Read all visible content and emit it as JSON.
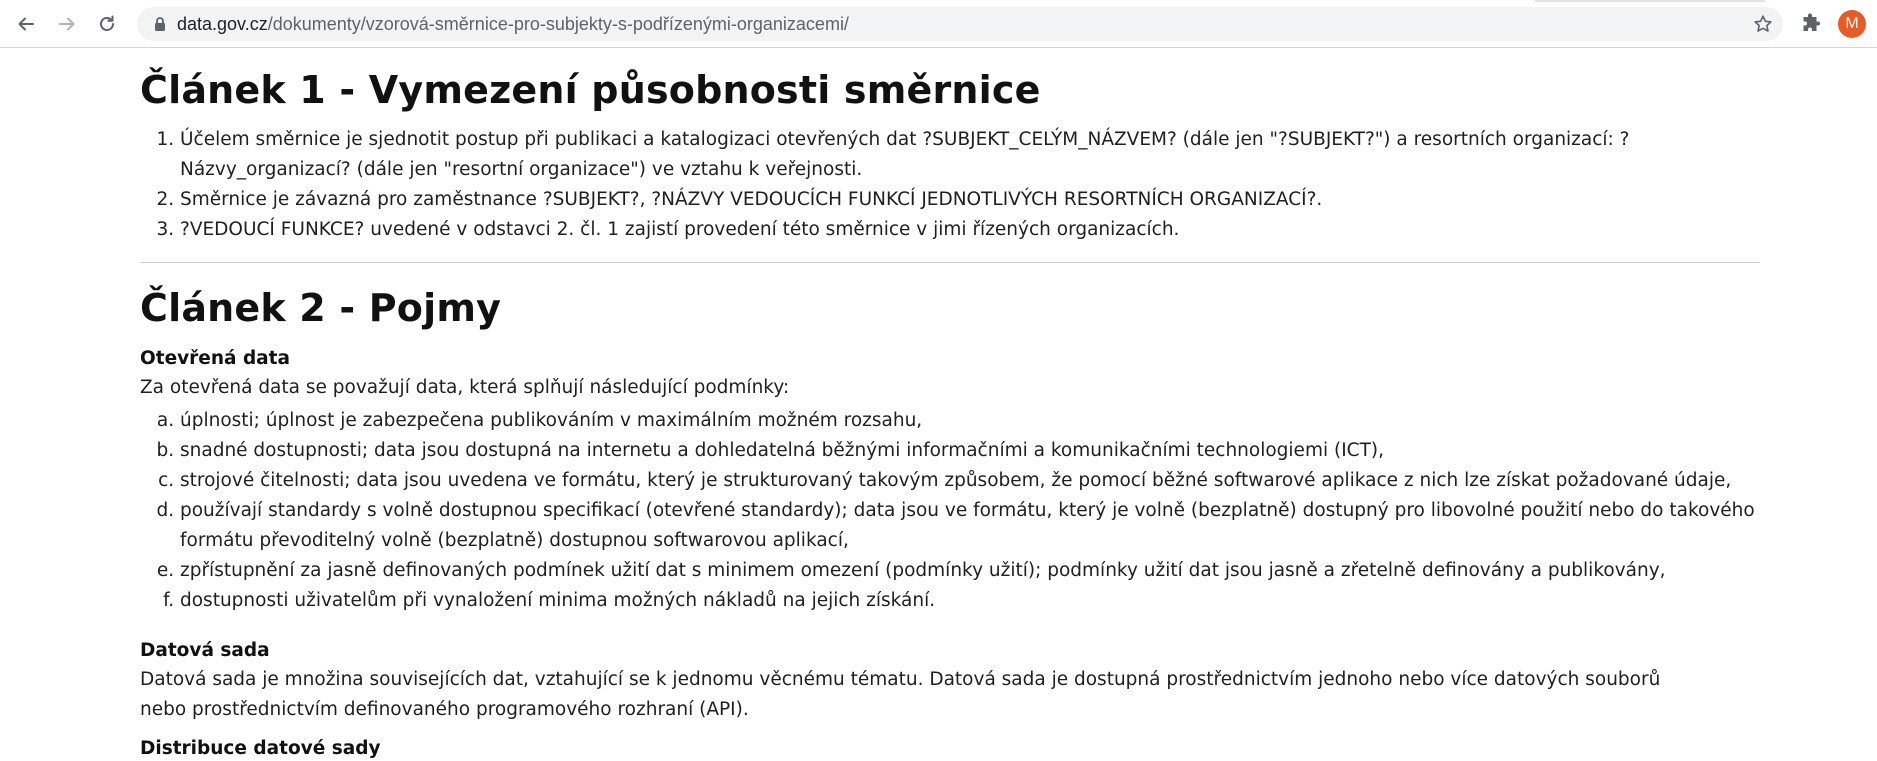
{
  "browser": {
    "url_host": "data.gov.cz",
    "url_path": "/dokumenty/vzorová-směrnice-pro-subjekty-s-podřízenými-organizacemi/",
    "avatar_letter": "M",
    "accent_color": "#ea5a24"
  },
  "article1": {
    "heading": "Článek 1 - Vymezení působnosti směrnice",
    "items": [
      "Účelem směrnice je sjednotit postup při publikaci a katalogizaci otevřených dat ?SUBJEKT_CELÝM_NÁZVEM? (dále jen \"?SUBJEKT?\") a resortních organizací: ?Názvy_organizací? (dále jen \"resortní organizace\") ve vztahu k veřejnosti.",
      "Směrnice je závazná pro zaměstnance ?SUBJEKT?, ?NÁZVY VEDOUCÍCH FUNKCÍ JEDNOTLIVÝCH RESORTNÍCH ORGANIZACÍ?.",
      "?VEDOUCÍ FUNKCE? uvedené v odstavci 2. čl. 1 zajistí provedení této směrnice v jimi řízených organizacích."
    ]
  },
  "article2": {
    "heading": "Článek 2 - Pojmy",
    "open_data": {
      "term": "Otevřená data",
      "intro": "Za otevřená data se považují data, která splňují následující podmínky:",
      "conditions": [
        "úplnosti; úplnost je zabezpečena publikováním v maximálním možném rozsahu,",
        "snadné dostupnosti; data jsou dostupná na internetu a dohledatelná běžnými informačními a komunikačními technologiemi (ICT),",
        "strojové čitelnosti; data jsou uvedena ve formátu, který je strukturovaný takovým způsobem, že pomocí běžné softwarové aplikace z nich lze získat požadované údaje,",
        "používají standardy s volně dostupnou specifikací (otevřené standardy); data jsou ve formátu, který je volně (bezplatně) dostupný pro libovolné použití nebo do takového formátu převoditelný volně (bezplatně) dostupnou softwarovou aplikací,",
        "zpřístupnění za jasně definovaných podmínek užití dat s minimem omezení (podmínky užití); podmínky užití dat jsou jasně a zřetelně definovány a publikovány,",
        "dostupnosti uživatelům při vynaložení minima možných nákladů na jejich získání."
      ]
    },
    "dataset": {
      "term": "Datová sada",
      "text": "Datová sada je množina souvisejících dat, vztahující se k jednomu věcnému tématu. Datová sada je dostupná prostřednictvím jednoho nebo více datových souborů nebo prostřednictvím definovaného programového rozhraní (API)."
    },
    "distribution": {
      "term": "Distribuce datové sady"
    }
  }
}
